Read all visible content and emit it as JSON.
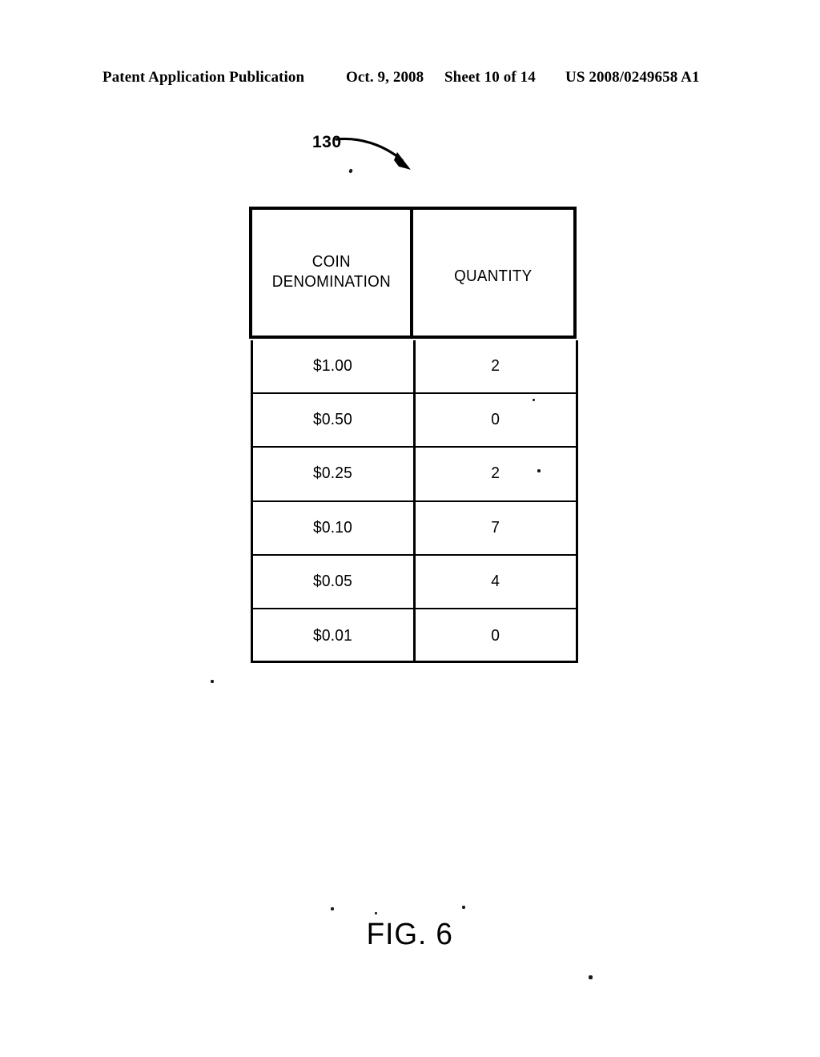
{
  "header": {
    "publication": "Patent Application Publication",
    "date": "Oct. 9, 2008",
    "sheet": "Sheet 10 of 14",
    "patent_number": "US 2008/0249658 A1"
  },
  "figure": {
    "reference_numeral": "130",
    "caption": "FIG. 6"
  },
  "table": {
    "columns": [
      {
        "label": "COIN\nDENOMINATION",
        "line1": "COIN",
        "line2": "DENOMINATION"
      },
      {
        "label": "QUANTITY",
        "line1": "QUANTITY",
        "line2": ""
      }
    ],
    "rows": [
      {
        "denomination": "$1.00",
        "quantity": "2"
      },
      {
        "denomination": "$0.50",
        "quantity": "0"
      },
      {
        "denomination": "$0.25",
        "quantity": "2"
      },
      {
        "denomination": "$0.10",
        "quantity": "7"
      },
      {
        "denomination": "$0.05",
        "quantity": "4"
      },
      {
        "denomination": "$0.01",
        "quantity": "0"
      }
    ]
  },
  "colors": {
    "ink": "#000000",
    "paper": "#ffffff"
  }
}
